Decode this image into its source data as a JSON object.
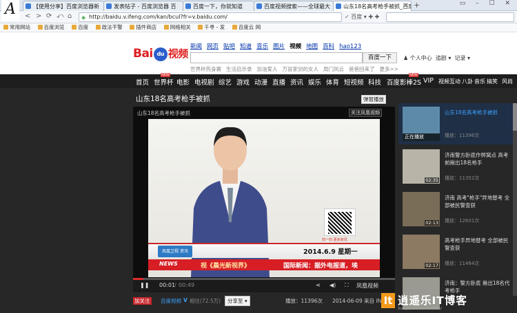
{
  "browser": {
    "tabs": [
      {
        "label": "【使用分享】百度浏览器新",
        "active": false
      },
      {
        "label": "发表帖子 - 百度浏览器 百",
        "active": false
      },
      {
        "label": "百度一下，你就知道",
        "active": false
      },
      {
        "label": "百度视频搜索——全球最大",
        "active": false
      },
      {
        "label": "山东18名高考枪手被抓_百度",
        "active": true
      }
    ],
    "url": "http://baidu.v.ifeng.com/kan/bcuI?fr=v.baidu.com/",
    "right_nav": "✓ 百度 ▾   ✚ ✚",
    "bookmarks": [
      "常用网站",
      "百度浏览",
      "百度",
      "政法干警",
      "插件商店",
      "网络相关",
      "千寻 - 发",
      "百度云 网"
    ]
  },
  "baidu": {
    "logo_text_left": "Bai",
    "logo_paw": "du",
    "logo_text_right": "视频",
    "channels": [
      "新闻",
      "网页",
      "贴吧",
      "知道",
      "音乐",
      "图片",
      "视频",
      "地图",
      "百科",
      "hao123"
    ],
    "selected_channel": "视频",
    "search_button": "百度一下",
    "user_links": [
      "个人中心",
      "追剧 ▾",
      "记录 ▾"
    ],
    "hot_links": [
      "世界杯热身赛",
      "生活启示录",
      "加油爱人",
      "万冒家剑的女人",
      "周门风云",
      "爸爸回来了",
      "更多>>"
    ]
  },
  "nav": {
    "items": [
      "首页",
      "世界杯",
      "电影",
      "电视剧",
      "综艺",
      "游戏",
      "动漫",
      "直播",
      "资讯",
      "娱乐",
      "体育",
      "短视频",
      "科技",
      "百度影棒2S",
      "VIP"
    ],
    "small_items": [
      "视频互动",
      "八卦",
      "音乐",
      "搞笑",
      "风尚"
    ],
    "new_badge": "NEW"
  },
  "video": {
    "title": "山东18名高考枪手被抓",
    "popup_button": "弹窗播放",
    "player_title": "山东18名高考枪手被抓",
    "follow_button": "关注凤凰视频",
    "qr_caption": "扫一扫 更多资讯",
    "banner_logo": "凤凰卫视 资讯",
    "banner_date": "2014.6.9 星期一",
    "banner_news": "NEWS",
    "ticker_left": "视《晨光新视界》",
    "ticker_right": "国际新闻：据外电报道，埃",
    "progress": 0.04,
    "time_current": "00:01",
    "time_total": "00:49",
    "brand": "凤凰视频"
  },
  "below_player": {
    "follow": "加关注",
    "channel": "百度视频",
    "verified": "V",
    "user_text": "相往(72.5万)",
    "share_button": "分享至 ▾",
    "plays": "播放：11396次",
    "date": "2014-06-09  来自 ifen"
  },
  "playlist": [
    {
      "title": "山东18名高考枪手被抓",
      "plays": "播放：11396次",
      "duration": "",
      "playing": "正在播放"
    },
    {
      "title": "济南警方卧底作弊窝点 高考前揪出18名枪手",
      "plays": "播放：11352次",
      "duration": "02:35",
      "playing": ""
    },
    {
      "title": "济南 高考\"枪手\"异地替考 全部被民警查获",
      "plays": "播放：12601次",
      "duration": "02:13",
      "playing": ""
    },
    {
      "title": "高考枪手异地替考 全部被民警查获",
      "plays": "播放：11464次",
      "duration": "02:17",
      "playing": ""
    },
    {
      "title": "济南：警方卧底 揪出18名代考枪手",
      "plays": "",
      "duration": "",
      "playing": ""
    }
  ],
  "watermark": {
    "logo": "It",
    "text": "逍遥乐IT博客",
    "url": "Xiaoyao.Beidou.com/805/"
  }
}
